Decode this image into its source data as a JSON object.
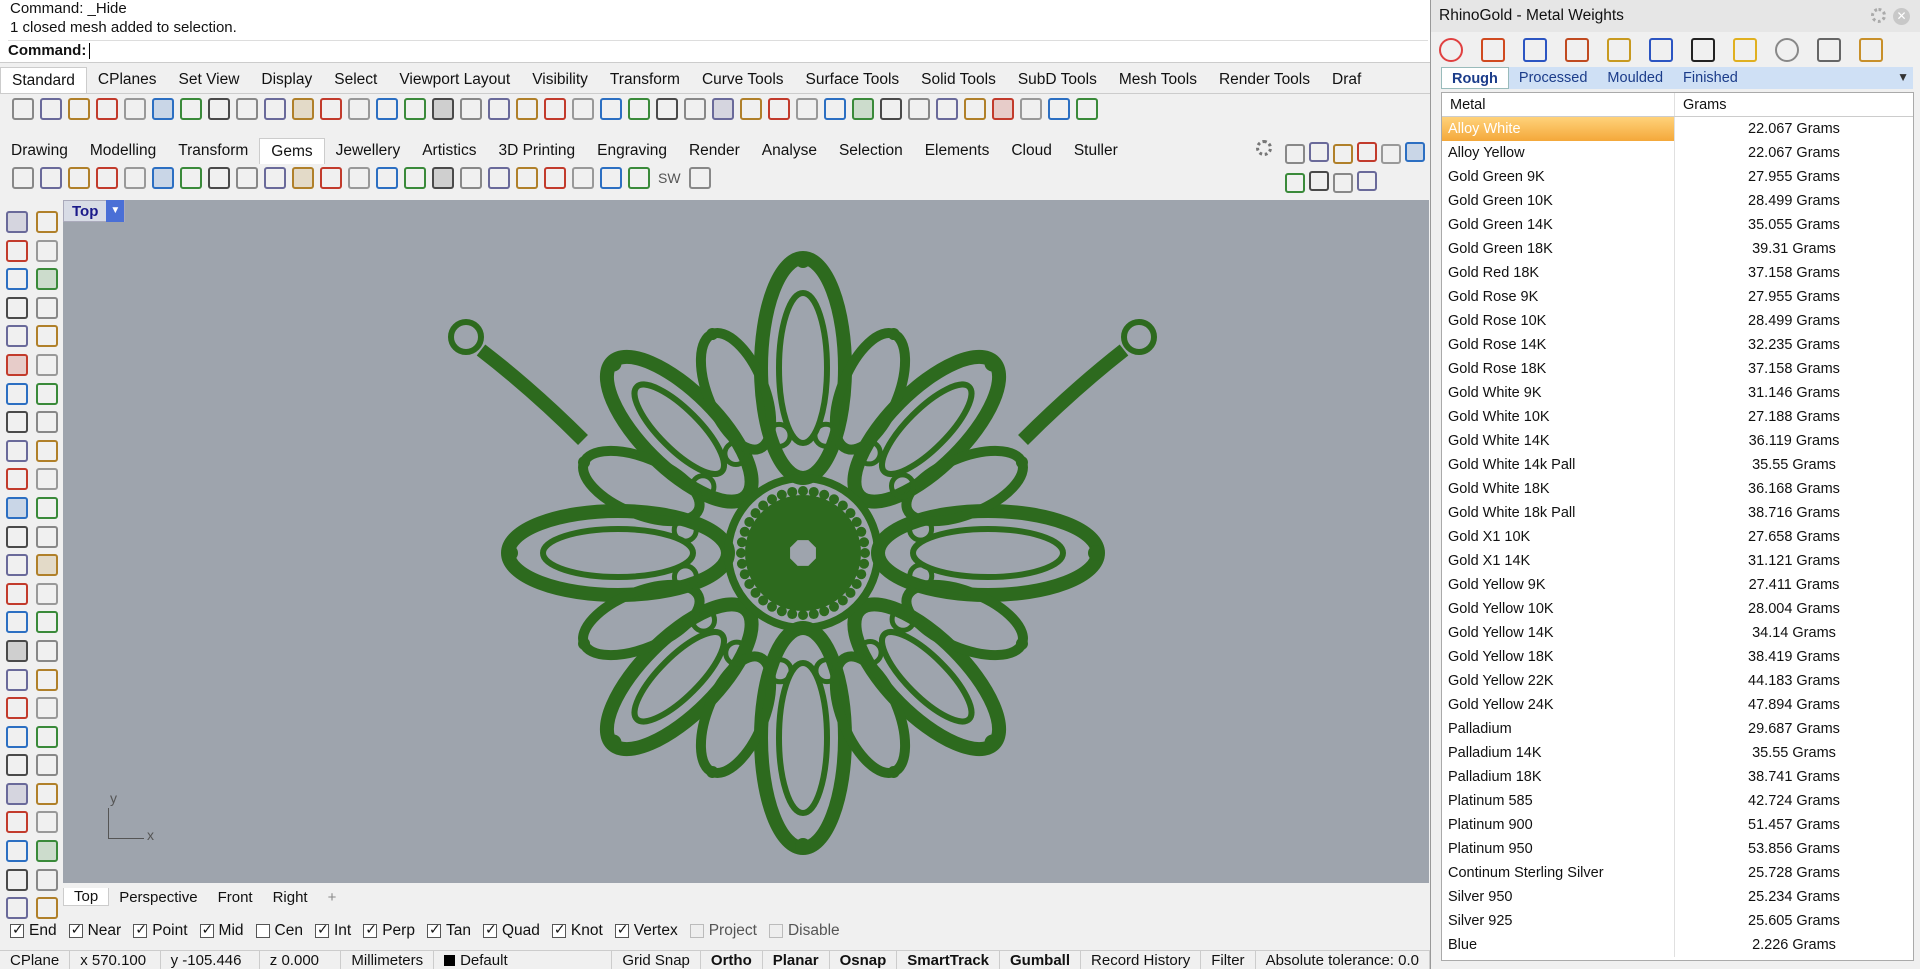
{
  "command": {
    "line1": "Command: _Hide",
    "line2": "1 closed mesh added to selection.",
    "prompt": "Command:"
  },
  "tabs1": [
    "Standard",
    "CPlanes",
    "Set View",
    "Display",
    "Select",
    "Viewport Layout",
    "Visibility",
    "Transform",
    "Curve Tools",
    "Surface Tools",
    "Solid Tools",
    "SubD Tools",
    "Mesh Tools",
    "Render Tools",
    "Draf"
  ],
  "tabs1_active": "Standard",
  "tabs2": [
    "Drawing",
    "Modelling",
    "Transform",
    "Gems",
    "Jewellery",
    "Artistics",
    "3D Printing",
    "Engraving",
    "Render",
    "Analyse",
    "Selection",
    "Elements",
    "Cloud",
    "Stuller"
  ],
  "tabs2_active": "Gems",
  "toolbar2_text": "SW",
  "viewport": {
    "name": "Top",
    "axis_y": "y",
    "axis_x": "x"
  },
  "viewport_tabs": [
    "Top",
    "Perspective",
    "Front",
    "Right"
  ],
  "osnaps": [
    {
      "label": "End",
      "on": true
    },
    {
      "label": "Near",
      "on": true
    },
    {
      "label": "Point",
      "on": true
    },
    {
      "label": "Mid",
      "on": true
    },
    {
      "label": "Cen",
      "on": false
    },
    {
      "label": "Int",
      "on": true
    },
    {
      "label": "Perp",
      "on": true
    },
    {
      "label": "Tan",
      "on": true
    },
    {
      "label": "Quad",
      "on": true
    },
    {
      "label": "Knot",
      "on": true
    },
    {
      "label": "Vertex",
      "on": true
    }
  ],
  "osnap_disabled": [
    "Project",
    "Disable"
  ],
  "status": {
    "cplane": "CPlane",
    "x": "x 570.100",
    "y": "y -105.446",
    "z": "z 0.000",
    "units": "Millimeters",
    "layer": "Default",
    "grid_snap": "Grid Snap",
    "ortho": "Ortho",
    "planar": "Planar",
    "osnap": "Osnap",
    "smarttrack": "SmartTrack",
    "gumball": "Gumball",
    "record_history": "Record History",
    "filter": "Filter",
    "tolerance": "Absolute tolerance: 0.0"
  },
  "panel": {
    "title": "RhinoGold - Metal Weights",
    "tabs": [
      "Rough",
      "Processed",
      "Moulded",
      "Finished"
    ],
    "active_tab": "Rough",
    "col_metal": "Metal",
    "col_grams": "Grams",
    "rows": [
      [
        "Alloy White",
        "22.067 Grams"
      ],
      [
        "Alloy Yellow",
        "22.067 Grams"
      ],
      [
        "Gold Green 9K",
        "27.955 Grams"
      ],
      [
        "Gold Green 10K",
        "28.499 Grams"
      ],
      [
        "Gold Green 14K",
        "35.055 Grams"
      ],
      [
        "Gold Green 18K",
        "39.31 Grams"
      ],
      [
        "Gold Red 18K",
        "37.158 Grams"
      ],
      [
        "Gold Rose 9K",
        "27.955 Grams"
      ],
      [
        "Gold Rose 10K",
        "28.499 Grams"
      ],
      [
        "Gold Rose 14K",
        "32.235 Grams"
      ],
      [
        "Gold Rose 18K",
        "37.158 Grams"
      ],
      [
        "Gold White 9K",
        "31.146 Grams"
      ],
      [
        "Gold White 10K",
        "27.188 Grams"
      ],
      [
        "Gold White 14K",
        "36.119 Grams"
      ],
      [
        "Gold White 14k Pall",
        "35.55 Grams"
      ],
      [
        "Gold White 18K",
        "36.168 Grams"
      ],
      [
        "Gold White 18k Pall",
        "38.716 Grams"
      ],
      [
        "Gold X1 10K",
        "27.658 Grams"
      ],
      [
        "Gold X1 14K",
        "31.121 Grams"
      ],
      [
        "Gold Yellow 9K",
        "27.411 Grams"
      ],
      [
        "Gold Yellow 10K",
        "28.004 Grams"
      ],
      [
        "Gold Yellow 14K",
        "34.14 Grams"
      ],
      [
        "Gold Yellow 18K",
        "38.419 Grams"
      ],
      [
        "Gold Yellow 22K",
        "44.183 Grams"
      ],
      [
        "Gold Yellow 24K",
        "47.894 Grams"
      ],
      [
        "Palladium",
        "29.687 Grams"
      ],
      [
        "Palladium 14K",
        "35.55 Grams"
      ],
      [
        "Palladium 18K",
        "38.741 Grams"
      ],
      [
        "Platinum 585",
        "42.724 Grams"
      ],
      [
        "Platinum 900",
        "51.457 Grams"
      ],
      [
        "Platinum 950",
        "53.856 Grams"
      ],
      [
        "Continum Sterling Silver",
        "25.728 Grams"
      ],
      [
        "Silver 950",
        "25.234 Grams"
      ],
      [
        "Silver 925",
        "25.605 Grams"
      ],
      [
        "Blue",
        "2.226 Grams"
      ]
    ],
    "selected_row": 0
  },
  "colors": {
    "viewport_bg": "#9ea4ad",
    "mesh_green": "#2d6a1e",
    "selection_orange": "#f4a83a"
  }
}
